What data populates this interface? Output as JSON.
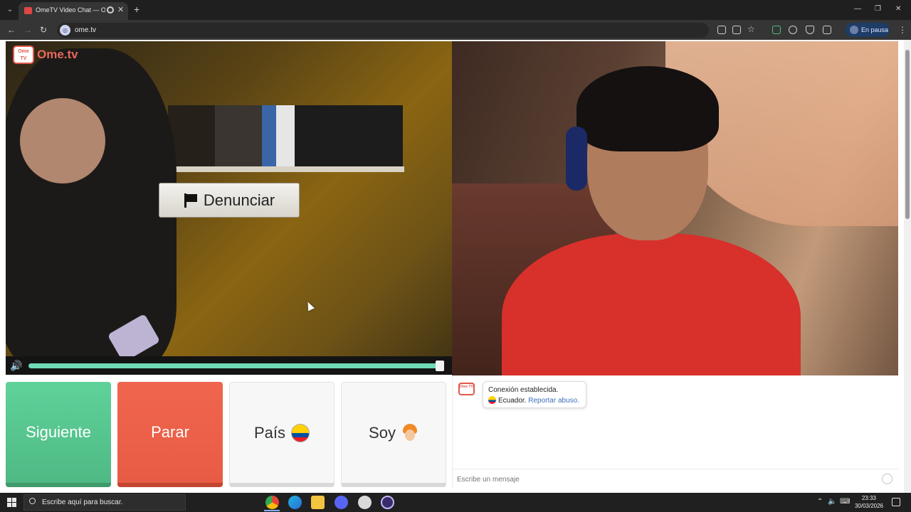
{
  "browser": {
    "tab_title": "OmeTV Video Chat — Ome...",
    "url": "ome.tv",
    "profile_label": "En pausa",
    "new_tab_symbol": "+",
    "close_symbol": "✕",
    "window_controls": {
      "minimize": "—",
      "maximize": "❐",
      "close": "✕"
    },
    "nav": {
      "back": "←",
      "forward": "→",
      "reload": "↻"
    }
  },
  "brand": {
    "logo_badge": "Ome TV",
    "logo_text": "Ome.tv",
    "accent_color": "#e0584b"
  },
  "video": {
    "report_label": "Denunciar",
    "volume_level": 1.0
  },
  "controls": {
    "next_label": "Siguiente",
    "stop_label": "Parar",
    "country_label": "País",
    "country_flag": "ecuador-flag-icon",
    "me_label": "Soy",
    "me_icon": "boy-avatar-icon",
    "next_color": "#5fd29a",
    "stop_color": "#f0654e"
  },
  "chat": {
    "system_line1": "Conexión establecida.",
    "country_name": "Ecuador.",
    "report_link": "Reportar abuso.",
    "input_placeholder": "Escribe un mensaje"
  },
  "taskbar": {
    "search_placeholder": "Escribe aquí para buscar.",
    "time": "23:33",
    "date": "30/03/2026",
    "apps": [
      "chrome-icon",
      "edge-icon",
      "file-explorer-icon",
      "discord-icon",
      "unity-icon",
      "obs-icon"
    ]
  }
}
